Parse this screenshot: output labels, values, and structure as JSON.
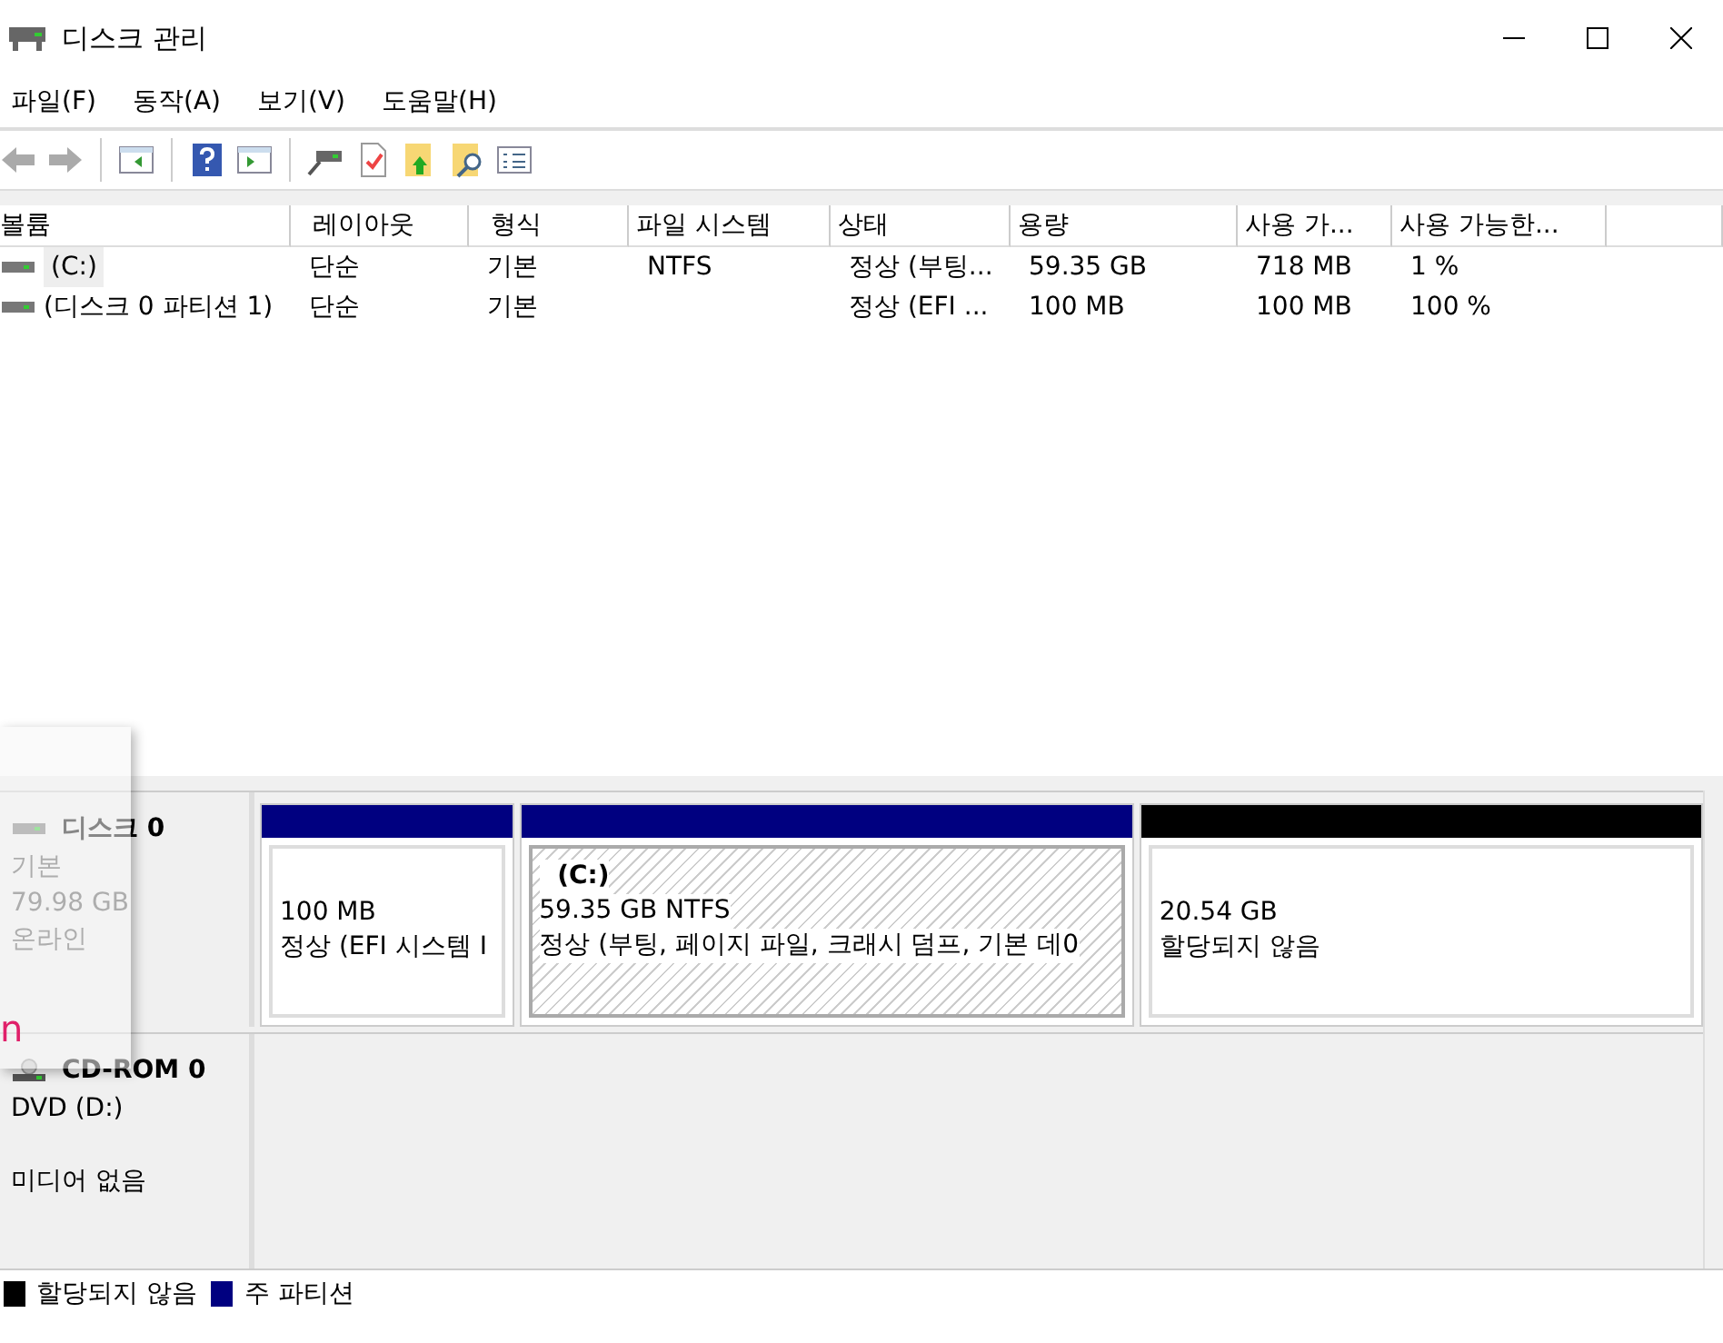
{
  "window": {
    "title": "디스크 관리"
  },
  "menu": [
    "파일(F)",
    "동작(A)",
    "보기(V)",
    "도움말(H)"
  ],
  "table": {
    "columns": [
      "볼륨",
      "레이아웃",
      "형식",
      "파일 시스템",
      "상태",
      "용량",
      "사용 가...",
      "사용 가능한..."
    ],
    "rows": [
      {
        "cells": [
          "(C:)",
          "단순",
          "기본",
          "NTFS",
          "정상 (부팅...",
          "59.35 GB",
          "718 MB",
          "1 %"
        ],
        "selected": true
      },
      {
        "cells": [
          "(디스크 0 파티션 1)",
          "단순",
          "기본",
          "",
          "정상 (EFI ...",
          "100 MB",
          "100 MB",
          "100 %"
        ],
        "selected": false
      }
    ]
  },
  "disks": [
    {
      "name": "디스크 0",
      "kind": "disk",
      "details": [
        "기본",
        "79.98 GB",
        "온라인"
      ],
      "partitions": [
        {
          "size": "100 MB",
          "status": "정상 (EFI 시스템 I",
          "color": "#000080",
          "selected": false
        },
        {
          "label": "(C:)",
          "size": "59.35 GB NTFS",
          "status": "정상 (부팅, 페이지 파일, 크래시 덤프, 기본 데0",
          "color": "#000080",
          "selected": true
        },
        {
          "size": "20.54 GB",
          "status": "할당되지 않음",
          "color": "#000000",
          "selected": false
        }
      ]
    },
    {
      "name": "CD-ROM 0",
      "kind": "cdrom",
      "details": [
        "DVD (D:)",
        "미디어 없음"
      ]
    }
  ],
  "legend": [
    {
      "label": "할당되지 않음",
      "color": "#000000"
    },
    {
      "label": "주 파티션",
      "color": "#000080"
    }
  ],
  "overlay_panel": {
    "text": "n"
  }
}
